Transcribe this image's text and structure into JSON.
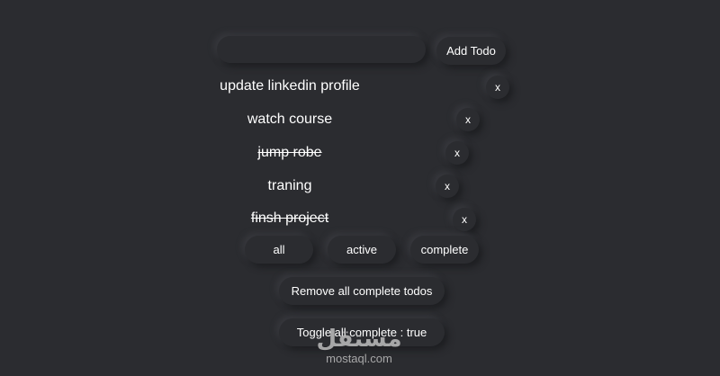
{
  "input": {
    "value": "",
    "placeholder": ""
  },
  "add_button": {
    "label": "Add Todo"
  },
  "todos": [
    {
      "text": "update linkedin profile",
      "completed": false,
      "delete_label": "x"
    },
    {
      "text": "watch course",
      "completed": false,
      "delete_label": "x"
    },
    {
      "text": "jump robe",
      "completed": true,
      "delete_label": "x"
    },
    {
      "text": "traning",
      "completed": false,
      "delete_label": "x"
    },
    {
      "text": "finsh project",
      "completed": true,
      "delete_label": "x"
    }
  ],
  "filters": [
    {
      "label": "all"
    },
    {
      "label": "active"
    },
    {
      "label": "complete"
    }
  ],
  "actions": {
    "remove_complete": "Remove all complete todos",
    "toggle_all": "Toggle all complete : true"
  },
  "watermark": {
    "logo": "مستقل",
    "domain": "mostaql.com"
  },
  "colors": {
    "background": "#2b2c30",
    "text": "#ffffff"
  }
}
